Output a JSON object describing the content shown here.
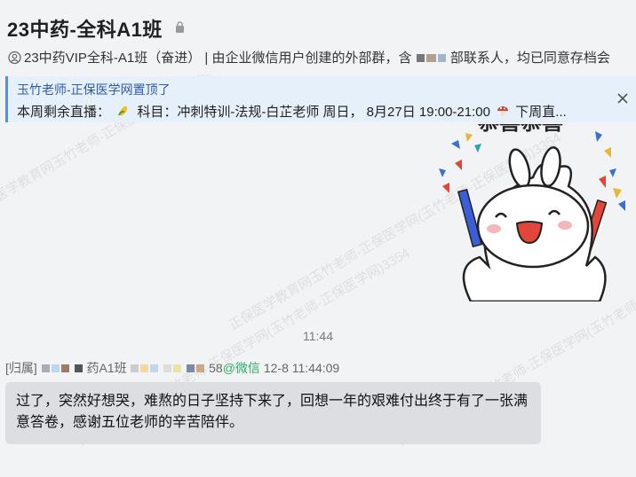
{
  "header": {
    "title": "23中药-全科A1班",
    "group_name": "23中药VIP全科-A1班（奋进）",
    "desc_part1": "| 由企业微信用户创建的外部群，含",
    "desc_part2": "部联系人，均已同意存档会"
  },
  "pinned": {
    "line1": "玉竹老师-正保医学网置顶了",
    "line2_prefix": "本周剩余直播：",
    "line2_text": "科目：冲刺特训-法规-白芷老师 周日， 8月27日 19:00-21:00",
    "line2_suffix": "下周直..."
  },
  "watermark_text": "正保医学教育网玉竹老师-正保医学网(玉竹老师-正保医学网)3354",
  "sticker_text": "恭喜恭喜",
  "time_separator": "11:44",
  "message": {
    "sender_prefix": "[归属]",
    "sender_mid": "药A1班",
    "sender_num": "58",
    "source": "@微信",
    "timestamp": "12-8 11:44:09",
    "text": "过了，突然好想哭，难熬的日子坚持下来了，回想一年的艰难付出终于有了一张满意答卷，感谢五位老师的辛苦陪伴。"
  },
  "colors": {
    "pin_bg": "#e6f0fb",
    "pin_accent": "#5b8fd6",
    "wechat_green": "#2aae67",
    "bubble_bg": "#dcdee2"
  }
}
